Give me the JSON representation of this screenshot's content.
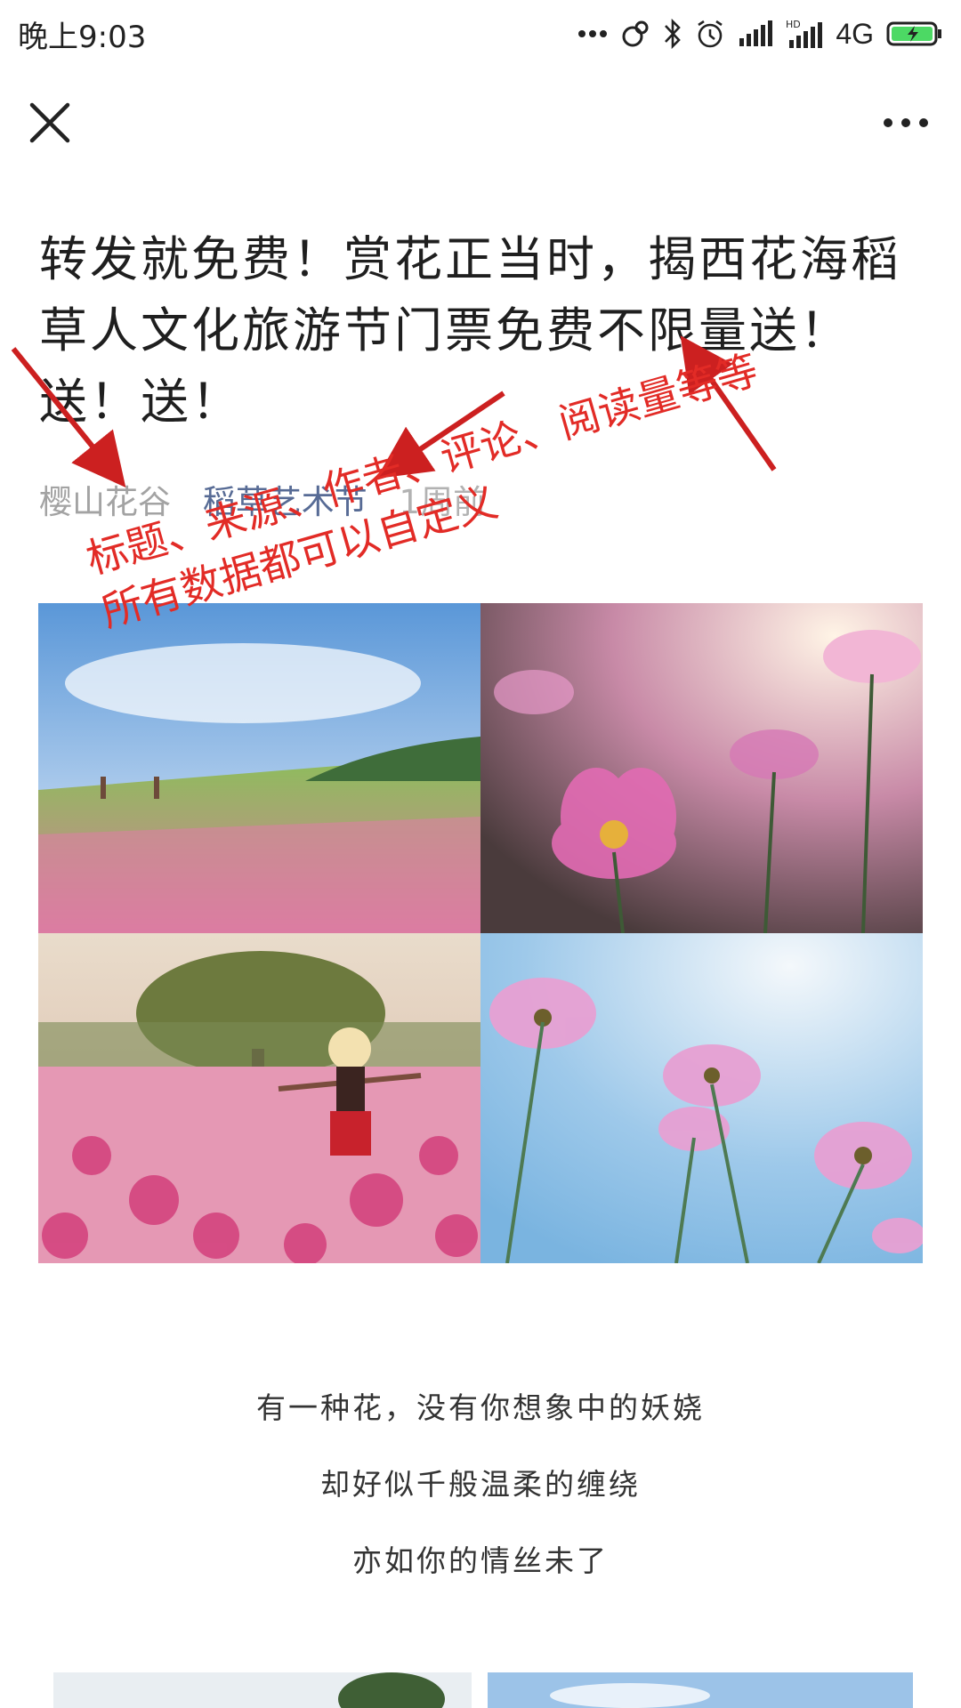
{
  "status_bar": {
    "time": "晚上9:03",
    "network": "4G",
    "icons": [
      "more-dots-icon",
      "location-icon",
      "bluetooth-icon",
      "alarm-icon",
      "signal-icon",
      "hd-signal-icon",
      "battery-charging-icon"
    ]
  },
  "nav": {
    "close_icon": "close-icon",
    "more_icon": "more-icon"
  },
  "article": {
    "title": "转发就免费！赏花正当时，揭西花海稻草人文化旅游节门票免费不限量送！送！送！",
    "source": "樱山花谷",
    "author": "稻草艺术节",
    "time": "1周前"
  },
  "photos": [
    "flower-field-photo",
    "pink-cosmos-closeup-photo",
    "girl-in-flower-field-photo",
    "cosmos-blue-sky-photo"
  ],
  "poem": {
    "lines": [
      "有一种花，没有你想象中的妖娆",
      "却好似千般温柔的缠绕",
      "亦如你的情丝未了"
    ]
  },
  "annotation": {
    "line1": "标题、来源、作者、评论、阅读量等等",
    "line2": "所有数据都可以自定义",
    "color": "#e22b26"
  },
  "colors": {
    "author_link": "#576b95",
    "source": "#a3a3a3",
    "time": "#b2b2b2"
  }
}
